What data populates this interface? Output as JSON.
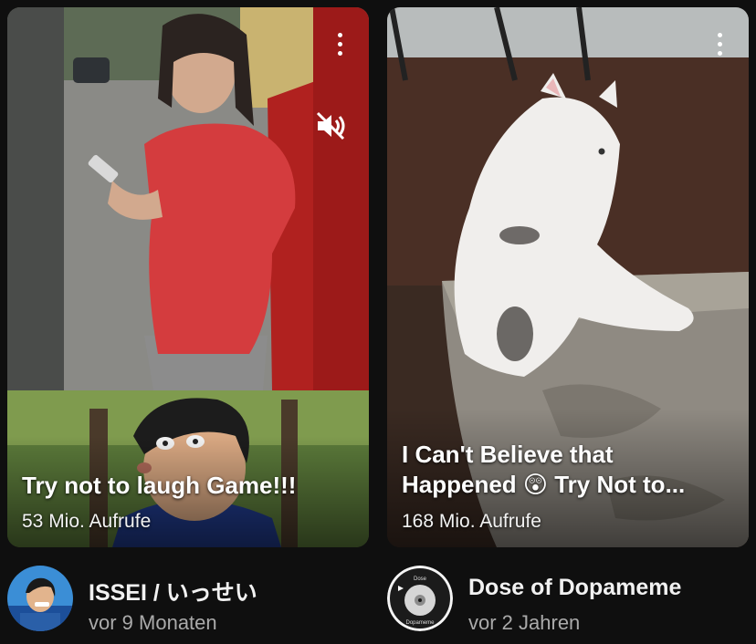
{
  "videos": [
    {
      "title": "Try not to laugh Game!!!",
      "views": "53 Mio. Aufrufe",
      "channel": "ISSEI / いっせい",
      "published": "vor 9 Monaten",
      "muted": true
    },
    {
      "title_line1": "I Can't Believe that",
      "title_line2": "Happened 😲 Try Not to...",
      "views": "168 Mio. Aufrufe",
      "channel": "Dose of Dopameme",
      "published": "vor 2 Jahren",
      "avatar_text_top": "Dose",
      "avatar_text_bottom": "Dopameme"
    }
  ],
  "icons": {
    "menu": "more-vert-icon",
    "mute": "volume-off-icon"
  }
}
